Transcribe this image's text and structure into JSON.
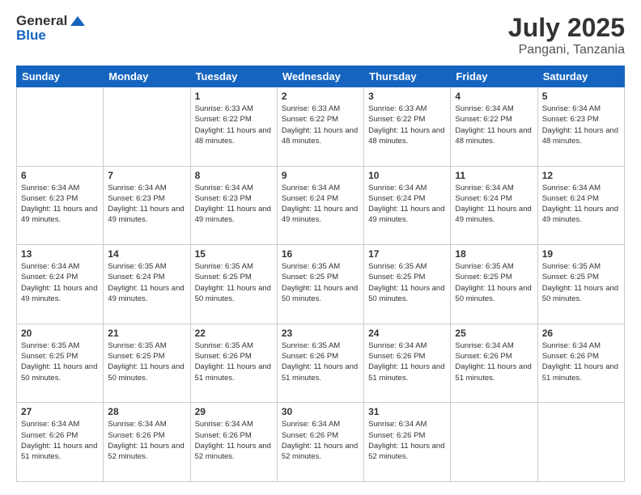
{
  "logo": {
    "general": "General",
    "blue": "Blue"
  },
  "title": {
    "month_year": "July 2025",
    "location": "Pangani, Tanzania"
  },
  "days_of_week": [
    "Sunday",
    "Monday",
    "Tuesday",
    "Wednesday",
    "Thursday",
    "Friday",
    "Saturday"
  ],
  "weeks": [
    [
      {
        "day": "",
        "content": ""
      },
      {
        "day": "",
        "content": ""
      },
      {
        "day": "1",
        "sunrise": "Sunrise: 6:33 AM",
        "sunset": "Sunset: 6:22 PM",
        "daylight": "Daylight: 11 hours and 48 minutes."
      },
      {
        "day": "2",
        "sunrise": "Sunrise: 6:33 AM",
        "sunset": "Sunset: 6:22 PM",
        "daylight": "Daylight: 11 hours and 48 minutes."
      },
      {
        "day": "3",
        "sunrise": "Sunrise: 6:33 AM",
        "sunset": "Sunset: 6:22 PM",
        "daylight": "Daylight: 11 hours and 48 minutes."
      },
      {
        "day": "4",
        "sunrise": "Sunrise: 6:34 AM",
        "sunset": "Sunset: 6:22 PM",
        "daylight": "Daylight: 11 hours and 48 minutes."
      },
      {
        "day": "5",
        "sunrise": "Sunrise: 6:34 AM",
        "sunset": "Sunset: 6:23 PM",
        "daylight": "Daylight: 11 hours and 48 minutes."
      }
    ],
    [
      {
        "day": "6",
        "sunrise": "Sunrise: 6:34 AM",
        "sunset": "Sunset: 6:23 PM",
        "daylight": "Daylight: 11 hours and 49 minutes."
      },
      {
        "day": "7",
        "sunrise": "Sunrise: 6:34 AM",
        "sunset": "Sunset: 6:23 PM",
        "daylight": "Daylight: 11 hours and 49 minutes."
      },
      {
        "day": "8",
        "sunrise": "Sunrise: 6:34 AM",
        "sunset": "Sunset: 6:23 PM",
        "daylight": "Daylight: 11 hours and 49 minutes."
      },
      {
        "day": "9",
        "sunrise": "Sunrise: 6:34 AM",
        "sunset": "Sunset: 6:24 PM",
        "daylight": "Daylight: 11 hours and 49 minutes."
      },
      {
        "day": "10",
        "sunrise": "Sunrise: 6:34 AM",
        "sunset": "Sunset: 6:24 PM",
        "daylight": "Daylight: 11 hours and 49 minutes."
      },
      {
        "day": "11",
        "sunrise": "Sunrise: 6:34 AM",
        "sunset": "Sunset: 6:24 PM",
        "daylight": "Daylight: 11 hours and 49 minutes."
      },
      {
        "day": "12",
        "sunrise": "Sunrise: 6:34 AM",
        "sunset": "Sunset: 6:24 PM",
        "daylight": "Daylight: 11 hours and 49 minutes."
      }
    ],
    [
      {
        "day": "13",
        "sunrise": "Sunrise: 6:34 AM",
        "sunset": "Sunset: 6:24 PM",
        "daylight": "Daylight: 11 hours and 49 minutes."
      },
      {
        "day": "14",
        "sunrise": "Sunrise: 6:35 AM",
        "sunset": "Sunset: 6:24 PM",
        "daylight": "Daylight: 11 hours and 49 minutes."
      },
      {
        "day": "15",
        "sunrise": "Sunrise: 6:35 AM",
        "sunset": "Sunset: 6:25 PM",
        "daylight": "Daylight: 11 hours and 50 minutes."
      },
      {
        "day": "16",
        "sunrise": "Sunrise: 6:35 AM",
        "sunset": "Sunset: 6:25 PM",
        "daylight": "Daylight: 11 hours and 50 minutes."
      },
      {
        "day": "17",
        "sunrise": "Sunrise: 6:35 AM",
        "sunset": "Sunset: 6:25 PM",
        "daylight": "Daylight: 11 hours and 50 minutes."
      },
      {
        "day": "18",
        "sunrise": "Sunrise: 6:35 AM",
        "sunset": "Sunset: 6:25 PM",
        "daylight": "Daylight: 11 hours and 50 minutes."
      },
      {
        "day": "19",
        "sunrise": "Sunrise: 6:35 AM",
        "sunset": "Sunset: 6:25 PM",
        "daylight": "Daylight: 11 hours and 50 minutes."
      }
    ],
    [
      {
        "day": "20",
        "sunrise": "Sunrise: 6:35 AM",
        "sunset": "Sunset: 6:25 PM",
        "daylight": "Daylight: 11 hours and 50 minutes."
      },
      {
        "day": "21",
        "sunrise": "Sunrise: 6:35 AM",
        "sunset": "Sunset: 6:25 PM",
        "daylight": "Daylight: 11 hours and 50 minutes."
      },
      {
        "day": "22",
        "sunrise": "Sunrise: 6:35 AM",
        "sunset": "Sunset: 6:26 PM",
        "daylight": "Daylight: 11 hours and 51 minutes."
      },
      {
        "day": "23",
        "sunrise": "Sunrise: 6:35 AM",
        "sunset": "Sunset: 6:26 PM",
        "daylight": "Daylight: 11 hours and 51 minutes."
      },
      {
        "day": "24",
        "sunrise": "Sunrise: 6:34 AM",
        "sunset": "Sunset: 6:26 PM",
        "daylight": "Daylight: 11 hours and 51 minutes."
      },
      {
        "day": "25",
        "sunrise": "Sunrise: 6:34 AM",
        "sunset": "Sunset: 6:26 PM",
        "daylight": "Daylight: 11 hours and 51 minutes."
      },
      {
        "day": "26",
        "sunrise": "Sunrise: 6:34 AM",
        "sunset": "Sunset: 6:26 PM",
        "daylight": "Daylight: 11 hours and 51 minutes."
      }
    ],
    [
      {
        "day": "27",
        "sunrise": "Sunrise: 6:34 AM",
        "sunset": "Sunset: 6:26 PM",
        "daylight": "Daylight: 11 hours and 51 minutes."
      },
      {
        "day": "28",
        "sunrise": "Sunrise: 6:34 AM",
        "sunset": "Sunset: 6:26 PM",
        "daylight": "Daylight: 11 hours and 52 minutes."
      },
      {
        "day": "29",
        "sunrise": "Sunrise: 6:34 AM",
        "sunset": "Sunset: 6:26 PM",
        "daylight": "Daylight: 11 hours and 52 minutes."
      },
      {
        "day": "30",
        "sunrise": "Sunrise: 6:34 AM",
        "sunset": "Sunset: 6:26 PM",
        "daylight": "Daylight: 11 hours and 52 minutes."
      },
      {
        "day": "31",
        "sunrise": "Sunrise: 6:34 AM",
        "sunset": "Sunset: 6:26 PM",
        "daylight": "Daylight: 11 hours and 52 minutes."
      },
      {
        "day": "",
        "content": ""
      },
      {
        "day": "",
        "content": ""
      }
    ]
  ]
}
